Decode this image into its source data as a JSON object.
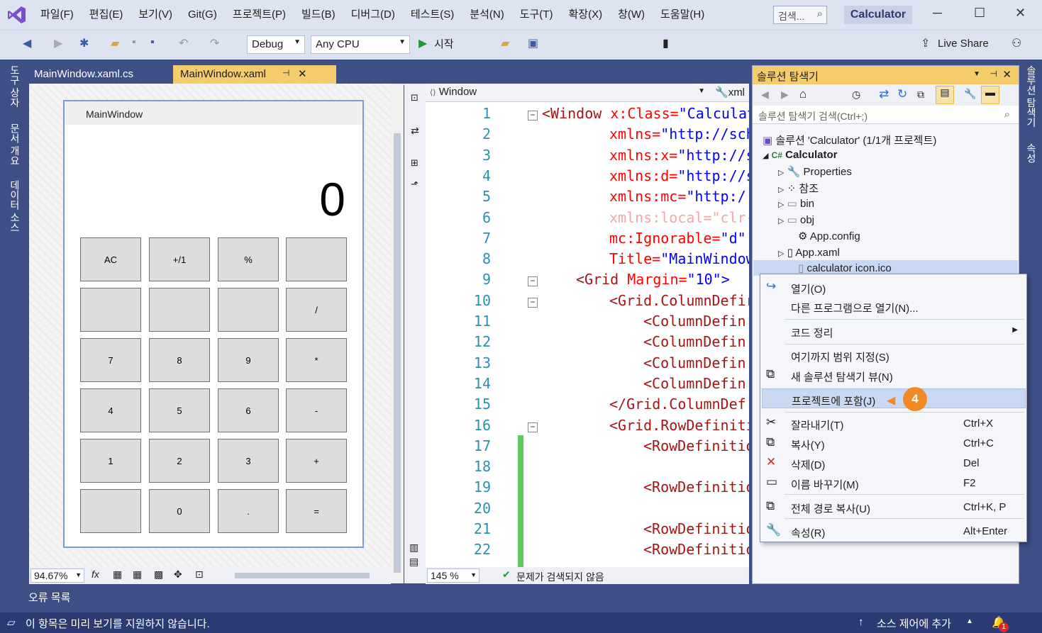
{
  "menu": [
    "파일(F)",
    "편집(E)",
    "보기(V)",
    "Git(G)",
    "프로젝트(P)",
    "빌드(B)",
    "디버그(D)",
    "테스트(S)",
    "분석(N)",
    "도구(T)",
    "확장(X)",
    "창(W)",
    "도움말(H)"
  ],
  "search_placeholder": "검색...",
  "app_name": "Calculator",
  "toolbar": {
    "config": "Debug",
    "platform": "Any CPU",
    "start_label": "시작",
    "live_share": "Live Share"
  },
  "left_tabs": [
    "도구 상자",
    "문서 개요",
    "데이터 소스"
  ],
  "right_tabs": [
    "솔루션 탐색기",
    "속성"
  ],
  "doc_tabs": [
    {
      "label": "MainWindow.xaml.cs"
    },
    {
      "label": "MainWindow.xaml"
    }
  ],
  "designer": {
    "window_title": "MainWindow",
    "display": "0",
    "zoom": "94.67%",
    "buttons": [
      "AC",
      "+/1",
      "%",
      "",
      "",
      "",
      "",
      "/",
      "7",
      "8",
      "9",
      "*",
      "4",
      "5",
      "6",
      "-",
      "1",
      "2",
      "3",
      "+",
      "",
      "0",
      ".",
      "="
    ]
  },
  "editor": {
    "element_combo": "Window",
    "element_combo2": "xml",
    "zoom": "145 %",
    "status": "문제가 검색되지 않음",
    "line_numbers": [
      "1",
      "2",
      "3",
      "4",
      "5",
      "6",
      "7",
      "8",
      "9",
      "10",
      "11",
      "12",
      "13",
      "14",
      "15",
      "16",
      "17",
      "18",
      "19",
      "20",
      "21",
      "22"
    ],
    "lines": [
      {
        "a": "<Window",
        "b": " x:Class=",
        "c": "\"Calculat"
      },
      {
        "a": "",
        "b": "xmlns=",
        "c": "\"http://sch"
      },
      {
        "a": "",
        "b": "xmlns:x=",
        "c": "\"http://s"
      },
      {
        "a": "",
        "b": "xmlns:d=",
        "c": "\"http://s"
      },
      {
        "a": "",
        "b": "xmlns:mc=",
        "c": "\"http:/."
      },
      {
        "a": "",
        "b": "xmlns:local=",
        "c": "\"clr-"
      },
      {
        "a": "",
        "b": "mc:Ignorable=",
        "c": "\"d\""
      },
      {
        "a": "",
        "b": "Title=",
        "c": "\"MainWindow"
      },
      {
        "a": "<Grid",
        "b": " Margin=",
        "c": "\"10\">"
      },
      {
        "a": "<Grid.ColumnDefir",
        "b": "",
        "c": ""
      },
      {
        "a": "<ColumnDefin",
        "b": "",
        "c": ""
      },
      {
        "a": "<ColumnDefin",
        "b": "",
        "c": ""
      },
      {
        "a": "<ColumnDefin",
        "b": "",
        "c": ""
      },
      {
        "a": "<ColumnDefin",
        "b": "",
        "c": ""
      },
      {
        "a": "</Grid.ColumnDef",
        "b": "",
        "c": ""
      },
      {
        "a": "<Grid.RowDefiniti",
        "b": "",
        "c": ""
      },
      {
        "a": "<RowDefinitio",
        "b": "",
        "c": ""
      },
      {
        "a": "",
        "b": "",
        "c": ""
      },
      {
        "a": "<RowDefinitio",
        "b": "",
        "c": ""
      },
      {
        "a": "",
        "b": "",
        "c": ""
      },
      {
        "a": "<RowDefinitio",
        "b": "",
        "c": ""
      },
      {
        "a": "<RowDefinitio",
        "b": "",
        "c": ""
      }
    ]
  },
  "solution_explorer": {
    "title": "솔루션 탐색기",
    "search": "솔루션 탐색기 검색(Ctrl+;)",
    "items": [
      "솔루션 'Calculator' (1/1개 프로젝트)",
      "Calculator",
      "Properties",
      "참조",
      "bin",
      "obj",
      "App.config",
      "App.xaml",
      "calculator icon.ico"
    ]
  },
  "context_menu": {
    "items": [
      {
        "label": "열기(O)",
        "shortcut": ""
      },
      {
        "label": "다른 프로그램으로 열기(N)...",
        "shortcut": ""
      },
      {
        "label": "코드 정리",
        "shortcut": ""
      },
      {
        "label": "여기까지 범위 지정(S)",
        "shortcut": ""
      },
      {
        "label": "새 솔루션 탐색기 뷰(N)",
        "shortcut": ""
      },
      {
        "label": "프로젝트에 포함(J)",
        "shortcut": ""
      },
      {
        "label": "잘라내기(T)",
        "shortcut": "Ctrl+X"
      },
      {
        "label": "복사(Y)",
        "shortcut": "Ctrl+C"
      },
      {
        "label": "삭제(D)",
        "shortcut": "Del"
      },
      {
        "label": "이름 바꾸기(M)",
        "shortcut": "F2"
      },
      {
        "label": "전체 경로 복사(U)",
        "shortcut": "Ctrl+K, P"
      },
      {
        "label": "속성(R)",
        "shortcut": "Alt+Enter"
      }
    ],
    "badge": "4"
  },
  "error_list_tab": "오류 목록",
  "status": {
    "message": "이 항목은 미리 보기를 지원하지 않습니다.",
    "source_control": "소스 제어에 추가",
    "notification_count": "1"
  }
}
